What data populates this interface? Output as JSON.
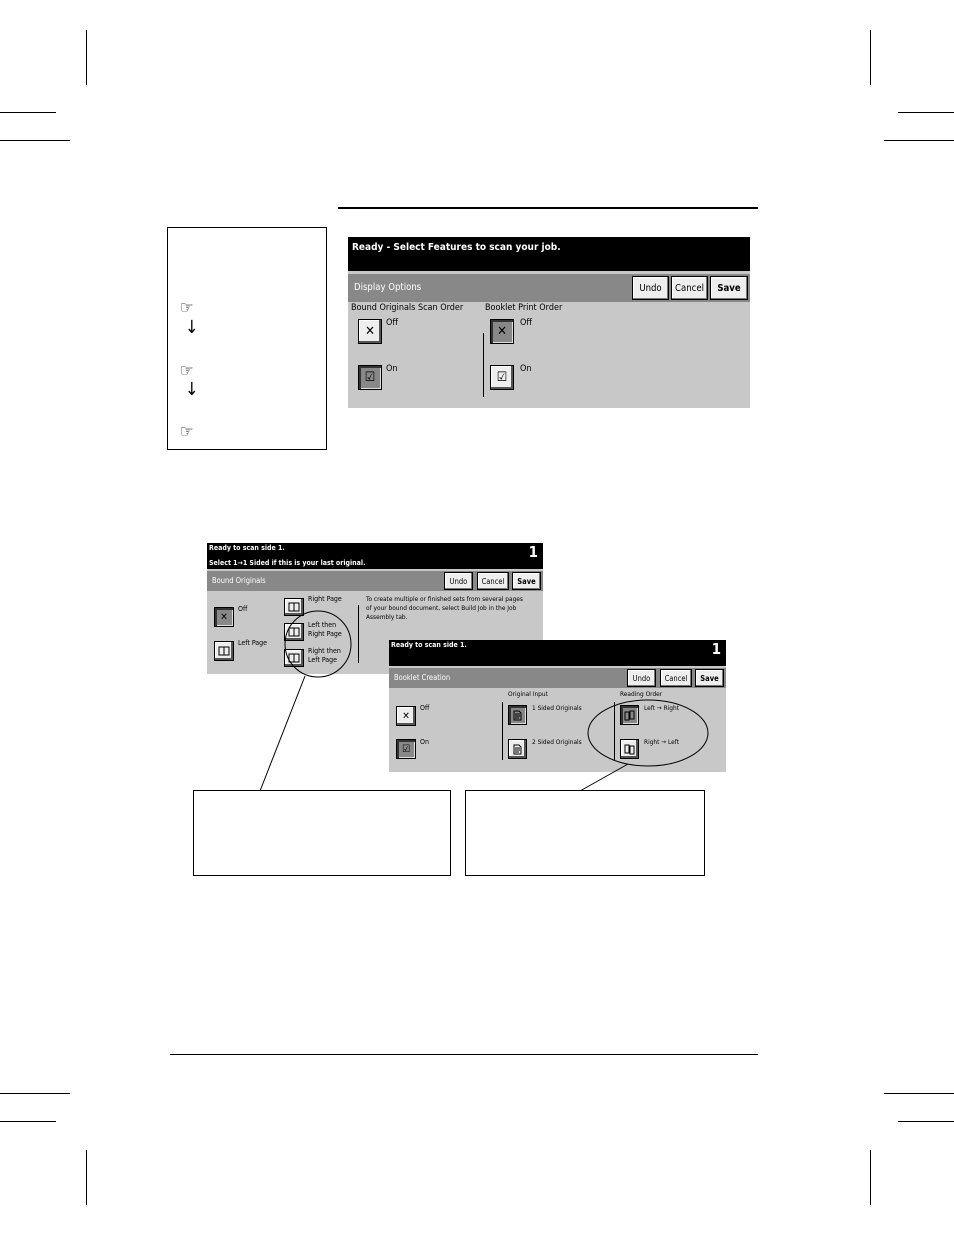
{
  "display_options_screen": {
    "message": "Ready -  Select Features to scan your job.",
    "tab_title": "Display Options",
    "undo_label": "Undo",
    "cancel_label": "Cancel",
    "save_label": "Save",
    "bound_originals_heading": "Bound Originals Scan Order",
    "booklet_heading": "Booklet Print Order",
    "off_label": "Off",
    "on_label": "On"
  },
  "bound_originals_screen": {
    "message_line1": "Ready to scan side 1.",
    "message_line2": "Select 1→1 Sided if this is your last original.",
    "counter": "1",
    "tab_title": "Bound Originals",
    "undo_label": "Undo",
    "cancel_label": "Cancel",
    "save_label": "Save",
    "off_label": "Off",
    "left_page_label": "Left Page",
    "right_page_label": "Right Page",
    "left_then_right_line1": "Left then",
    "left_then_right_line2": "Right Page",
    "right_then_left_line1": "Right then",
    "right_then_left_line2": "Left Page",
    "info_line1": "To create multiple or finished sets from several pages",
    "info_line2": "of your bound document, select Build Job in the Job",
    "info_line3": "Assembly tab."
  },
  "booklet_creation_screen": {
    "message": "Ready to scan side 1.",
    "counter": "1",
    "tab_title": "Booklet Creation",
    "undo_label": "Undo",
    "cancel_label": "Cancel",
    "save_label": "Save",
    "off_label": "Off",
    "on_label": "On",
    "original_input_heading": "Original Input",
    "one_sided_label": "1 Sided Originals",
    "two_sided_label": "2 Sided Originals",
    "reading_order_heading": "Reading Order",
    "left_to_right_label": "Left → Right",
    "right_to_left_label": "Right → Left"
  },
  "icons": {
    "pointing_hand": "☞",
    "down_arrow": "↓",
    "check": "☑",
    "cross": "✕"
  }
}
